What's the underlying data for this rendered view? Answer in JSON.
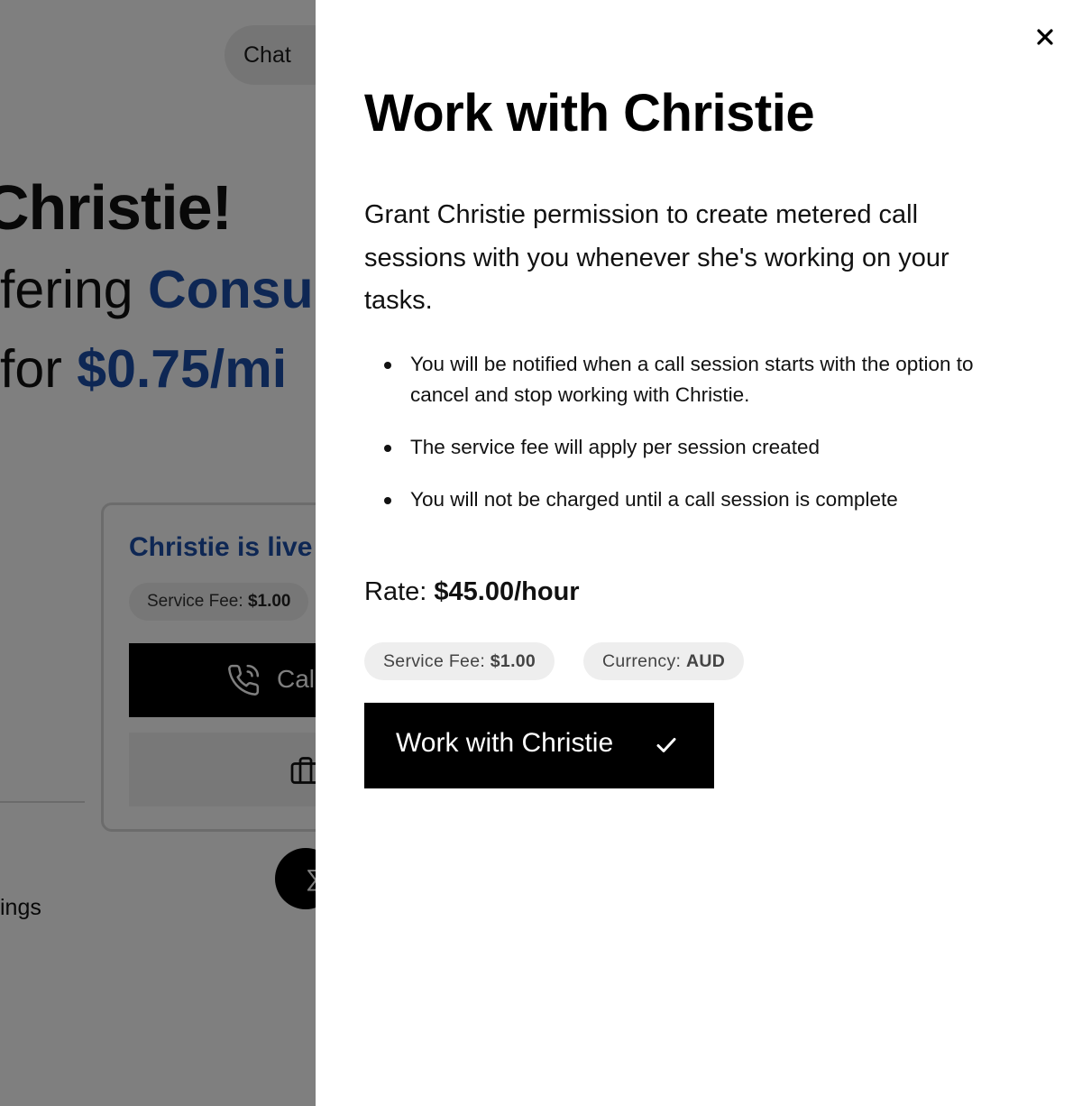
{
  "background": {
    "chat_label": "Chat",
    "headline": "Christie!",
    "line1_prefix": "fering",
    "line1_accent": "Consu",
    "line2_prefix": "for",
    "line2_accent": "$0.75/mi",
    "card": {
      "title": "Christie is live",
      "fee_label": "Service Fee:",
      "fee_value": "$1.00",
      "call_label": "Cal"
    },
    "settings_label": "ings"
  },
  "drawer": {
    "title": "Work with Christie",
    "description": "Grant Christie permission to create metered call sessions with you whenever she's working on your tasks.",
    "bullets": [
      "You will be notified when a call session starts with the option to cancel and stop working with Christie.",
      "The service fee will apply per session created",
      "You will not be charged until a call session is complete"
    ],
    "rate_label": "Rate:",
    "rate_value": "$45.00/hour",
    "fee_label": "Service Fee:",
    "fee_value": "$1.00",
    "currency_label": "Currency:",
    "currency_value": "AUD",
    "work_button_label": "Work with Christie",
    "close_icon": "close-icon",
    "check_icon": "check-icon"
  },
  "colors": {
    "accent_blue": "#1d4ea8",
    "overlay": "rgba(0,0,0,0.5)",
    "button_bg": "#000000",
    "pill_bg": "#eeeeee"
  }
}
